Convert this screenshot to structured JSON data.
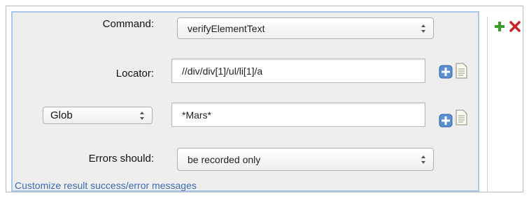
{
  "form": {
    "command_label": "Command:",
    "command_value": "verifyElementText",
    "locator_label": "Locator:",
    "locator_value": "//div/div[1]/ul/li[1]/a",
    "match_type": "Glob",
    "pattern_value": "*Mars*",
    "errors_label": "Errors should:",
    "errors_value": "be recorded only",
    "customize_link": "Customize result success/error messages"
  },
  "icons": {
    "add_step": "plus-icon",
    "delete_step": "close-x-icon",
    "locator_add": "plus-square-icon",
    "locator_doc": "document-icon",
    "pattern_add": "plus-square-icon",
    "pattern_doc": "document-icon"
  },
  "colors": {
    "panel_border": "#a9c7ea",
    "panel_bg": "#eeeeee",
    "link": "#3d6bb5",
    "plus_green": "#3a9a2a",
    "close_red": "#cc2222"
  }
}
